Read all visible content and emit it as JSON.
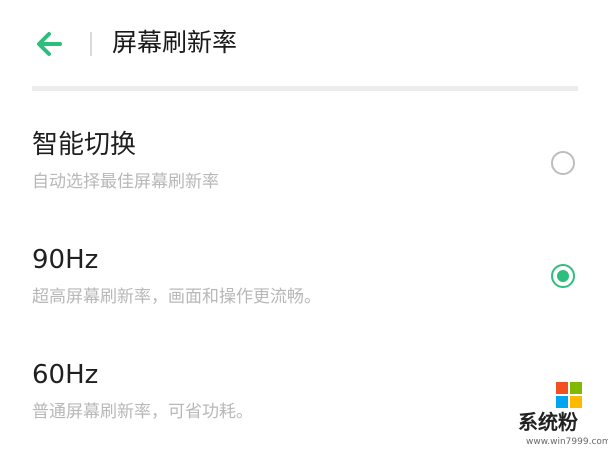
{
  "header": {
    "title": "屏幕刷新率",
    "back_icon": "arrow-left-icon",
    "accent_color": "#2fbd7d"
  },
  "options": [
    {
      "title": "智能切换",
      "description": "自动选择最佳屏幕刷新率",
      "selected": false
    },
    {
      "title": "90Hz",
      "description": "超高屏幕刷新率，画面和操作更流畅。",
      "selected": true
    },
    {
      "title": "60Hz",
      "description": "普通屏幕刷新率，可省功耗。",
      "selected": false
    }
  ],
  "watermark": {
    "text": "系统粉",
    "url": "www.win7999.com",
    "logo_colors": [
      "#f25022",
      "#7fba00",
      "#00a4ef",
      "#ffb900"
    ]
  }
}
